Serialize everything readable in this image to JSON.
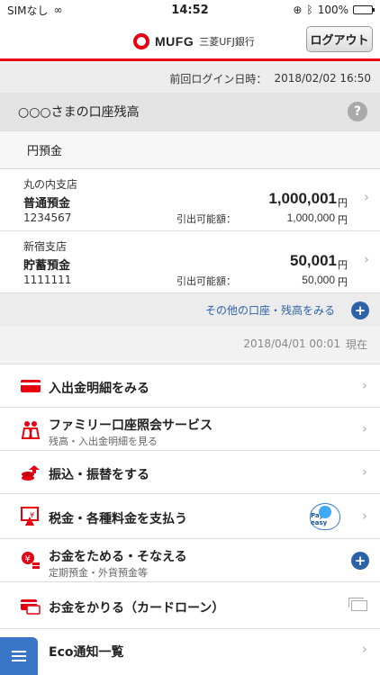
{
  "status": {
    "carrier": "SIMなし",
    "time": "14:52",
    "battery": "100%",
    "battery_level": 1.0
  },
  "header": {
    "logo_text": "MUFG",
    "logo_sub": "三菱UFJ銀行",
    "logout_label": "ログアウト"
  },
  "last_login": {
    "label": "前回ログイン日時：",
    "value": "2018/02/02 16:50"
  },
  "balance": {
    "title": "○○○さまの口座残高",
    "help": "?",
    "section_label": "円預金",
    "available_label": "引出可能額：",
    "yen": "円",
    "accounts": [
      {
        "branch": "丸の内支店",
        "type": "普通預金",
        "number": "1234567",
        "balance": "1,000,001",
        "available": "1,000,000"
      },
      {
        "branch": "新宿支店",
        "type": "貯蓄預金",
        "number": "1111111",
        "balance": "50,001",
        "available": "50,000"
      }
    ],
    "other_accounts_label": "その他の口座・残高をみる",
    "as_of_date": "2018/04/01 00:01",
    "as_of_suffix": "現在"
  },
  "menu": {
    "items": [
      {
        "label": "入出金明細をみる",
        "sub": ""
      },
      {
        "label": "ファミリー口座照会サービス",
        "sub": "残高・入出金明細を見る"
      },
      {
        "label": "振込・振替をする",
        "sub": ""
      },
      {
        "label": "税金・各種料金を支払う",
        "sub": "",
        "badge": "Pay-easy"
      },
      {
        "label": "お金をためる・そなえる",
        "sub": "定期預金・外貨預金等"
      },
      {
        "label": "お金をかりる（カードローン）",
        "sub": ""
      },
      {
        "label": "Eco通知一覧",
        "sub": ""
      }
    ]
  },
  "colors": {
    "brand_red": "#e60012",
    "link_blue": "#2e62a8"
  }
}
